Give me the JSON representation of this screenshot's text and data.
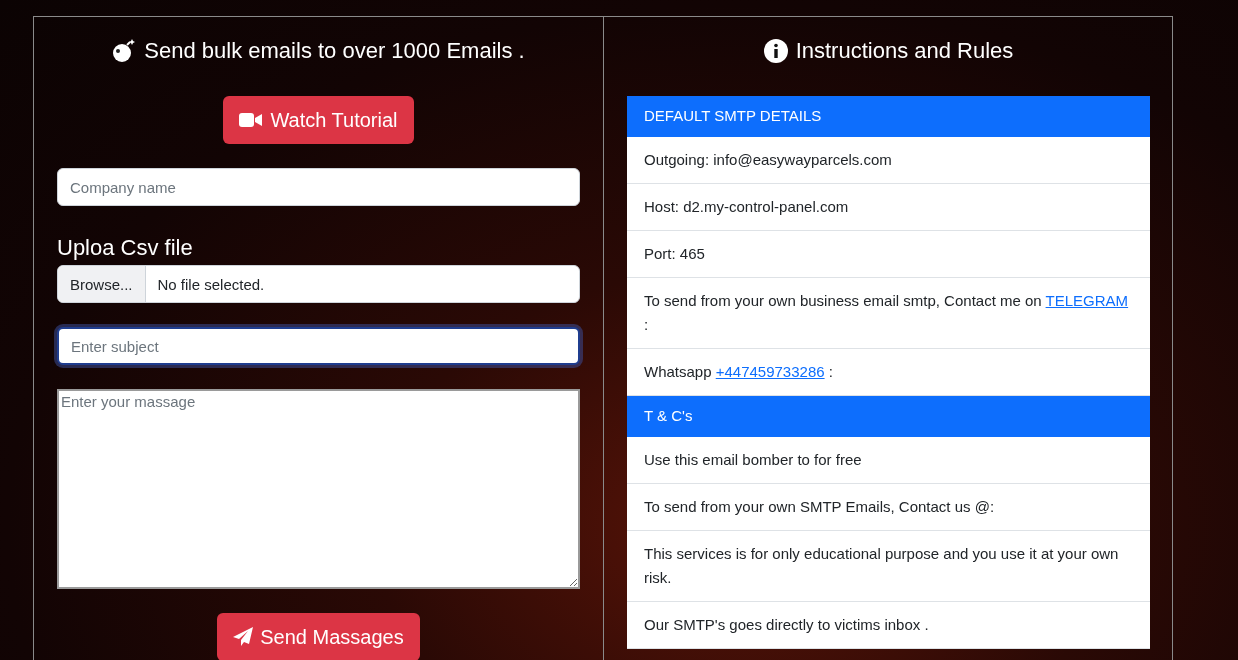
{
  "left_panel": {
    "title": "Send bulk emails to over 1000 Emails .",
    "tutorial_button": "Watch Tutorial",
    "company_field": {
      "placeholder": "Company name"
    },
    "upload_label": "Uploa Csv file",
    "file_field": {
      "button": "Browse...",
      "status": "No file selected."
    },
    "subject_field": {
      "placeholder": "Enter subject",
      "focused": true
    },
    "message_field": {
      "placeholder": "Enter your massage"
    },
    "send_button": "Send Massages"
  },
  "right_panel": {
    "title": "Instructions and Rules",
    "list": [
      {
        "kind": "header",
        "text": "DEFAULT SMTP DETAILS"
      },
      {
        "kind": "item",
        "text": "Outgoing: info@easywayparcels.com"
      },
      {
        "kind": "item",
        "text": "Host: d2.my-control-panel.com"
      },
      {
        "kind": "item",
        "text": "Port: 465"
      },
      {
        "kind": "item",
        "text": "To send from your own business email smtp, Contact me on",
        "link": "TELEGRAM",
        "after": ":"
      },
      {
        "kind": "item",
        "text": "Whatsapp",
        "link": "+447459733286",
        "after": ":"
      },
      {
        "kind": "header",
        "text": "T & C's"
      },
      {
        "kind": "item",
        "text": "Use this email bomber to for free"
      },
      {
        "kind": "item",
        "text": "To send from your own SMTP Emails, Contact us @:"
      },
      {
        "kind": "item",
        "text": "This services is for only educational purpose and you use it at your own risk."
      },
      {
        "kind": "item",
        "text": "Our SMTP's goes directly to victims inbox ."
      }
    ]
  }
}
